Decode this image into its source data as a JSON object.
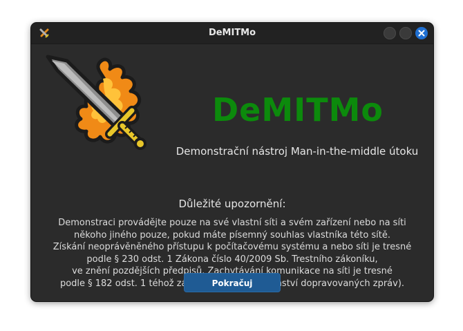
{
  "window": {
    "title": "DeMITMo",
    "app_icon": "sword-icon",
    "controls": [
      "minimize-button",
      "maximize-button",
      "close-button"
    ]
  },
  "header": {
    "logo_icon": "flaming-sword-logo",
    "app_name": "DeMITMo",
    "subtitle": "Demonstrační nástroj Man-in-the-middle útoku"
  },
  "notice": {
    "heading": "Důležité upozornění:",
    "lines": [
      "Demonstraci provádějte pouze na své vlastní síti a svém zařízení nebo na síti",
      "někoho jiného pouze, pokud máte písemný souhlas vlastníka této sítě.",
      "Získání neoprávěněného přístupu k počítačovému systému a nebo síti je tresné",
      "podle § 230 odst. 1 Zákona číslo 40/2009 Sb. Trestního zákoníku,",
      "ve znění pozdějších předpisů. Zachytávání komunikace na síti je tresné",
      "podle § 182 odst. 1 téhož zákona (Porušení tajemství dopravovaných zpráv)."
    ]
  },
  "actions": {
    "continue_label": "Pokračuj"
  },
  "colors": {
    "accent": "#1f5b94",
    "app_name": "#0c8a0c",
    "background": "#2b2b2b",
    "close": "#1f6fd1"
  }
}
